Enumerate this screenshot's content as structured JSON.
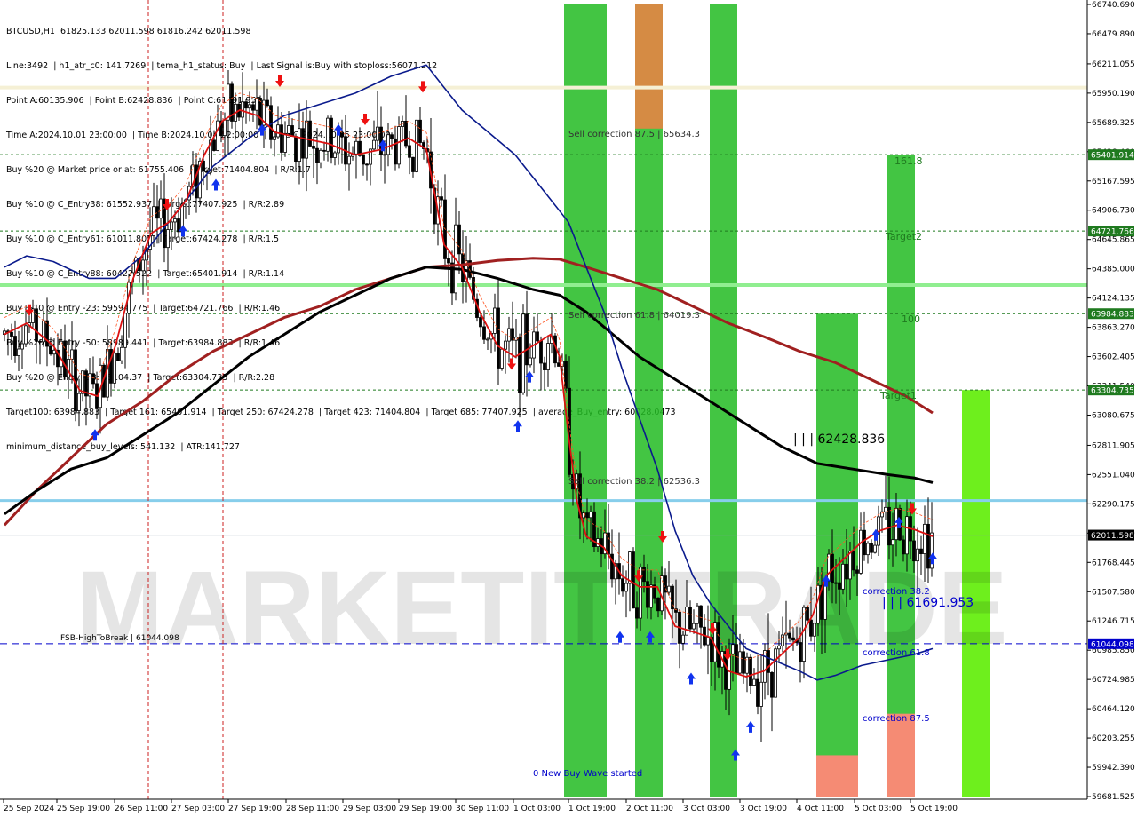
{
  "header_lines": [
    "BTCUSD,H1  61825.133 62011.598 61816.242 62011.598",
    "Line:3492  | h1_atr_c0: 141.7269  | tema_h1_status: Buy  | Last Signal is:Buy with stoploss:56071.212",
    "Point A:60135.906  | Point B:62428.836  | Point C:61691.953",
    "Time A:2024.10.01 23:00:00  | Time B:2024.10.04 22:00:00  | Time C:2024.10.05 23:00:00",
    "Buy %20 @ Market price or at: 61755.406  | Target:71404.804  | R/R:1.7",
    "Buy %10 @ C_Entry38: 61552.937  | Target:77407.925  | R/R:2.89",
    "Buy %10 @ C_Entry61: 61011.805  | Target:67424.278  | R/R:1.5",
    "Buy %10 @ C_Entry88: 60422.522  | Target:65401.914  | R/R:1.14",
    "Buy %10 @ Entry -23: 59594.775  | Target:64721.766  | R/R:1.46",
    "Buy %20 @ Entry -50: 58989.441  | Target:63984.883  | R/R:1.46",
    "Buy %20 @ Entry -88: 58104.37  | Target:63304.735  | R/R:2.28",
    "Target100: 63984.883  | Target 161: 65401.914  | Target 250: 67424.278  | Target 423: 71404.804  | Target 685: 77407.925  | average_Buy_entry: 60028.0473",
    "minimum_distance_buy_levels: 541.132  | ATR:141.727"
  ],
  "watermark": "MARKETIT TRADE",
  "colors": {
    "ema_red": "#dd1111",
    "ema_blue": "#0a1a8c",
    "ma_black": "#000000",
    "ma_brown": "#a02020",
    "green_bar": "#22bb22",
    "lime_bar": "#66ee11",
    "orange_bar": "#dd8844",
    "salmon_bar": "#ff8877",
    "level_green": "#1f7a1f",
    "level_blue": "#0000cc",
    "level_cyan": "#87ceeb",
    "price_tag": "#000000"
  },
  "chart_data": {
    "type": "candlestick",
    "symbol": "BTCUSD",
    "timeframe": "H1",
    "ylim": [
      59681.525,
      66740.69
    ],
    "y_ticks": [
      "66740.690",
      "66479.890",
      "66211.055",
      "65950.190",
      "65689.325",
      "65428.460",
      "65167.595",
      "64906.730",
      "64645.865",
      "64385.000",
      "64124.135",
      "63863.270",
      "63602.405",
      "63341.540",
      "63080.675",
      "62811.905",
      "62551.040",
      "62290.175",
      "62029.310",
      "61768.445",
      "61507.580",
      "61246.715",
      "60985.850",
      "60724.985",
      "60464.120",
      "60203.255",
      "59942.390",
      "59681.525"
    ],
    "x_ticks": [
      "25 Sep 2024",
      "25 Sep 19:00",
      "26 Sep 11:00",
      "27 Sep 03:00",
      "27 Sep 19:00",
      "28 Sep 11:00",
      "29 Sep 03:00",
      "29 Sep 19:00",
      "30 Sep 11:00",
      "1 Oct 03:00",
      "1 Oct 19:00",
      "2 Oct 11:00",
      "3 Oct 03:00",
      "3 Oct 19:00",
      "4 Oct 11:00",
      "5 Oct 03:00",
      "5 Oct 19:00"
    ],
    "current_price": "62011.598",
    "tagged_levels": [
      {
        "label": "65401.914",
        "value": 65401.914,
        "style": "green-dash"
      },
      {
        "label": "64721.766",
        "value": 64721.766,
        "style": "green-dash"
      },
      {
        "label": "63984.883",
        "value": 63984.883,
        "style": "green-dash"
      },
      {
        "label": "63304.735",
        "value": 63304.735,
        "style": "green-dash"
      },
      {
        "label": "61044.098",
        "value": 61044.098,
        "style": "blue-dash"
      }
    ],
    "horizontal_lines": [
      {
        "value": 66000,
        "color": "#f5f0d5"
      },
      {
        "value": 64240,
        "color": "#90ee90"
      },
      {
        "value": 62320,
        "color": "#87ceeb"
      },
      {
        "value": 62011.598,
        "color": "#8898aa"
      }
    ],
    "annotations": [
      "Sell correction 87.5 | 65634.3",
      "Sell correction 61.8 | 64019.3",
      "Sell correction 38.2 | 62536.3",
      "| | | 62428.836",
      "| | | 61691.953",
      "correction 38.2",
      "correction 61.8",
      "correction 87.5",
      "161.8",
      "Target2",
      "100",
      "Target1",
      "0 New Buy Wave started",
      "FSB-HighToBreak  |  61044.098"
    ],
    "ema_red": [
      [
        5,
        63800
      ],
      [
        30,
        63900
      ],
      [
        60,
        63700
      ],
      [
        90,
        63300
      ],
      [
        110,
        63250
      ],
      [
        130,
        63700
      ],
      [
        150,
        64300
      ],
      [
        170,
        64700
      ],
      [
        190,
        64800
      ],
      [
        210,
        65000
      ],
      [
        230,
        65400
      ],
      [
        250,
        65700
      ],
      [
        270,
        65800
      ],
      [
        290,
        65750
      ],
      [
        310,
        65600
      ],
      [
        340,
        65550
      ],
      [
        370,
        65500
      ],
      [
        400,
        65400
      ],
      [
        430,
        65450
      ],
      [
        460,
        65550
      ],
      [
        480,
        65450
      ],
      [
        500,
        64600
      ],
      [
        520,
        64400
      ],
      [
        540,
        64000
      ],
      [
        560,
        63700
      ],
      [
        580,
        63600
      ],
      [
        600,
        63700
      ],
      [
        620,
        63800
      ],
      [
        630,
        63600
      ],
      [
        640,
        62900
      ],
      [
        650,
        62300
      ],
      [
        660,
        62000
      ],
      [
        680,
        61900
      ],
      [
        700,
        61650
      ],
      [
        720,
        61550
      ],
      [
        740,
        61550
      ],
      [
        760,
        61200
      ],
      [
        780,
        61150
      ],
      [
        800,
        61100
      ],
      [
        820,
        60800
      ],
      [
        840,
        60750
      ],
      [
        860,
        60800
      ],
      [
        880,
        60950
      ],
      [
        900,
        61100
      ],
      [
        915,
        61300
      ],
      [
        930,
        61650
      ],
      [
        950,
        61800
      ],
      [
        970,
        61950
      ],
      [
        990,
        62050
      ],
      [
        1010,
        62100
      ],
      [
        1030,
        62060
      ],
      [
        1050,
        62000
      ]
    ],
    "ema_blue": [
      [
        5,
        64400
      ],
      [
        30,
        64500
      ],
      [
        60,
        64450
      ],
      [
        100,
        64300
      ],
      [
        130,
        64300
      ],
      [
        160,
        64500
      ],
      [
        200,
        64900
      ],
      [
        240,
        65300
      ],
      [
        280,
        65550
      ],
      [
        320,
        65750
      ],
      [
        360,
        65850
      ],
      [
        400,
        65950
      ],
      [
        440,
        66100
      ],
      [
        480,
        66200
      ],
      [
        500,
        66000
      ],
      [
        520,
        65800
      ],
      [
        550,
        65600
      ],
      [
        580,
        65400
      ],
      [
        610,
        65100
      ],
      [
        640,
        64800
      ],
      [
        660,
        64400
      ],
      [
        680,
        64000
      ],
      [
        700,
        63500
      ],
      [
        720,
        63050
      ],
      [
        740,
        62600
      ],
      [
        760,
        62050
      ],
      [
        780,
        61650
      ],
      [
        800,
        61400
      ],
      [
        820,
        61200
      ],
      [
        840,
        61000
      ],
      [
        870,
        60900
      ],
      [
        900,
        60800
      ],
      [
        920,
        60720
      ],
      [
        940,
        60760
      ],
      [
        970,
        60850
      ],
      [
        1000,
        60900
      ],
      [
        1030,
        60950
      ],
      [
        1050,
        61000
      ]
    ],
    "ma_black": [
      [
        5,
        62200
      ],
      [
        40,
        62400
      ],
      [
        80,
        62600
      ],
      [
        120,
        62700
      ],
      [
        160,
        62900
      ],
      [
        200,
        63100
      ],
      [
        240,
        63350
      ],
      [
        280,
        63600
      ],
      [
        320,
        63800
      ],
      [
        360,
        64000
      ],
      [
        400,
        64150
      ],
      [
        440,
        64300
      ],
      [
        480,
        64400
      ],
      [
        520,
        64380
      ],
      [
        560,
        64300
      ],
      [
        600,
        64200
      ],
      [
        630,
        64150
      ],
      [
        660,
        64000
      ],
      [
        690,
        63800
      ],
      [
        720,
        63600
      ],
      [
        760,
        63400
      ],
      [
        800,
        63200
      ],
      [
        840,
        63000
      ],
      [
        880,
        62800
      ],
      [
        920,
        62650
      ],
      [
        960,
        62600
      ],
      [
        1000,
        62550
      ],
      [
        1030,
        62520
      ],
      [
        1050,
        62480
      ]
    ],
    "ma_brown": [
      [
        5,
        62100
      ],
      [
        40,
        62400
      ],
      [
        80,
        62700
      ],
      [
        120,
        63000
      ],
      [
        160,
        63200
      ],
      [
        200,
        63450
      ],
      [
        240,
        63650
      ],
      [
        280,
        63800
      ],
      [
        320,
        63950
      ],
      [
        360,
        64050
      ],
      [
        400,
        64200
      ],
      [
        440,
        64300
      ],
      [
        480,
        64400
      ],
      [
        520,
        64420
      ],
      [
        560,
        64460
      ],
      [
        600,
        64480
      ],
      [
        630,
        64470
      ],
      [
        660,
        64400
      ],
      [
        700,
        64300
      ],
      [
        740,
        64200
      ],
      [
        780,
        64050
      ],
      [
        820,
        63900
      ],
      [
        860,
        63780
      ],
      [
        900,
        63650
      ],
      [
        940,
        63550
      ],
      [
        980,
        63400
      ],
      [
        1020,
        63250
      ],
      [
        1050,
        63100
      ]
    ],
    "vertical_bars": [
      {
        "x": [
          635,
          683
        ],
        "from": 59681.525,
        "to": 66740.69,
        "color_key": "green_bar"
      },
      {
        "x": [
          715,
          746
        ],
        "from": 59681.525,
        "to": 66740.69,
        "color_key": "green_bar"
      },
      {
        "x": [
          715,
          746
        ],
        "from": 65634.3,
        "to": 66740.69,
        "color_key": "orange_bar"
      },
      {
        "x": [
          799,
          830
        ],
        "from": 59681.525,
        "to": 66740.69,
        "color_key": "green_bar"
      },
      {
        "x": [
          919,
          966
        ],
        "from": 59681.525,
        "to": 63984.883,
        "color_key": "green_bar"
      },
      {
        "x": [
          919,
          966
        ],
        "from": 59681.525,
        "to": 60050,
        "color_key": "salmon_bar"
      },
      {
        "x": [
          999,
          1030
        ],
        "from": 59681.525,
        "to": 65401.914,
        "color_key": "green_bar"
      },
      {
        "x": [
          999,
          1030
        ],
        "from": 59681.525,
        "to": 60420,
        "color_key": "salmon_bar"
      },
      {
        "x": [
          1083,
          1114
        ],
        "from": 59681.525,
        "to": 63304.735,
        "color_key": "lime_bar"
      }
    ]
  }
}
